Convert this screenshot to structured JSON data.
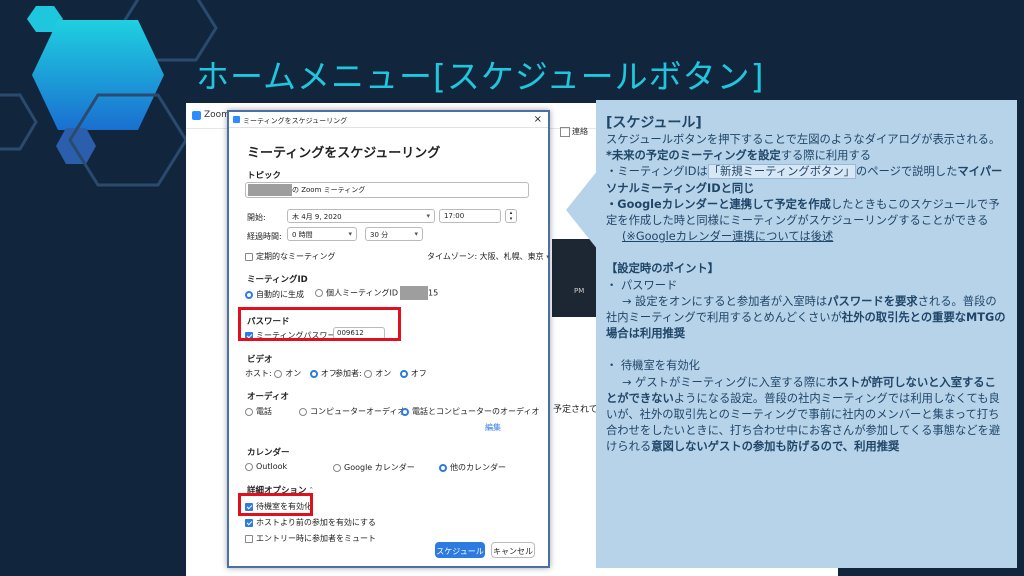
{
  "slide": {
    "title": "ホームメニュー[スケジュールボタン]"
  },
  "zoom_app": {
    "label": "Zoom",
    "toolbar_item": "連絡",
    "text_right": "予定されてい",
    "text_mid": "PM",
    "text_top": "15"
  },
  "dialog": {
    "window_title": "ミーティングをスケジューリング",
    "close": "×",
    "heading": "ミーティングをスケジューリング",
    "topic": {
      "label": "トピック",
      "value_suffix": "の Zoom ミーティング"
    },
    "start": {
      "label": "開始:",
      "date": "木 4月 9, 2020",
      "time": "17:00"
    },
    "duration": {
      "label": "経過時間:",
      "hours": "0 時間",
      "minutes": "30 分"
    },
    "recurring_label": "定期的なミーティング",
    "timezone": "タイムゾーン: 大阪、札幌、東京",
    "meeting_id": {
      "label": "ミーティングID",
      "auto": "自動的に生成",
      "personal": "個人ミーティングID",
      "personal_suffix": "15"
    },
    "password": {
      "label": "パスワード",
      "checkbox": "ミーティングパスワード必須",
      "value": "009612"
    },
    "video": {
      "label": "ビデオ",
      "host": "ホスト:",
      "participants": "参加者:",
      "on": "オン",
      "off": "オフ"
    },
    "audio": {
      "label": "オーディオ",
      "phone": "電話",
      "computer": "コンピューターオーディオ",
      "both": "電話とコンピューターのオーディオ",
      "edit": "編集"
    },
    "calendar": {
      "label": "カレンダー",
      "outlook": "Outlook",
      "google": "Google カレンダー",
      "other": "他のカレンダー"
    },
    "advanced": {
      "label": "詳細オプション",
      "waiting_room": "待機室を有効化",
      "join_before": "ホストより前の参加を有効にする",
      "mute_on_entry": "エントリー時に参加者をミュート"
    },
    "schedule_button": "スケジュール",
    "cancel_button": "キャンセル"
  },
  "explain": {
    "heading": "[スケジュール]",
    "intro": "スケジュールボタンを押下することで左図のようなダイアログが表示される。",
    "p1_bold": "*未来の予定のミーティングを設定",
    "p1_rest": "する際に利用する",
    "p2_a": "・ミーティングIDは",
    "p2_hl": "「新規ミーティングボタン」",
    "p2_b": "のページで説明した",
    "p2_bold": "マイパーソナルミーティングIDと同じ",
    "p3_bold": "・Googleカレンダーと連携して予定を作成",
    "p3_rest": "したときもこのスケジュールで予定を作成した時と同様にミーティングがスケジューリングすることができる",
    "p4": "(※Googleカレンダー連携については後述",
    "points_heading": "【設定時のポイント】",
    "pw_title": "・ パスワード",
    "pw_a": "→ 設定をオンにすると参加者が入室時は",
    "pw_bold1": "パスワードを要求",
    "pw_b": "される。普段の社内ミーティングで利用するとめんどくさいが",
    "pw_bold2": "社外の取引先との重要なMTGの場合は利用推奨",
    "wr_title": "・ 待機室を有効化",
    "wr_a": "→ ゲストがミーティングに入室する際に",
    "wr_bold1": "ホストが許可しないと入室することができない",
    "wr_b": "ようになる設定。普段の社内ミーティングでは利用しなくても良いが、社外の取引先とのミーティングで事前に社内のメンバーと集まって打ち合わせをしたいときに、打ち合わせ中にお客さんが参加してくる事態などを避けられる",
    "wr_bold2": "意図しないゲストの参加も防げるので、利用推奨"
  }
}
